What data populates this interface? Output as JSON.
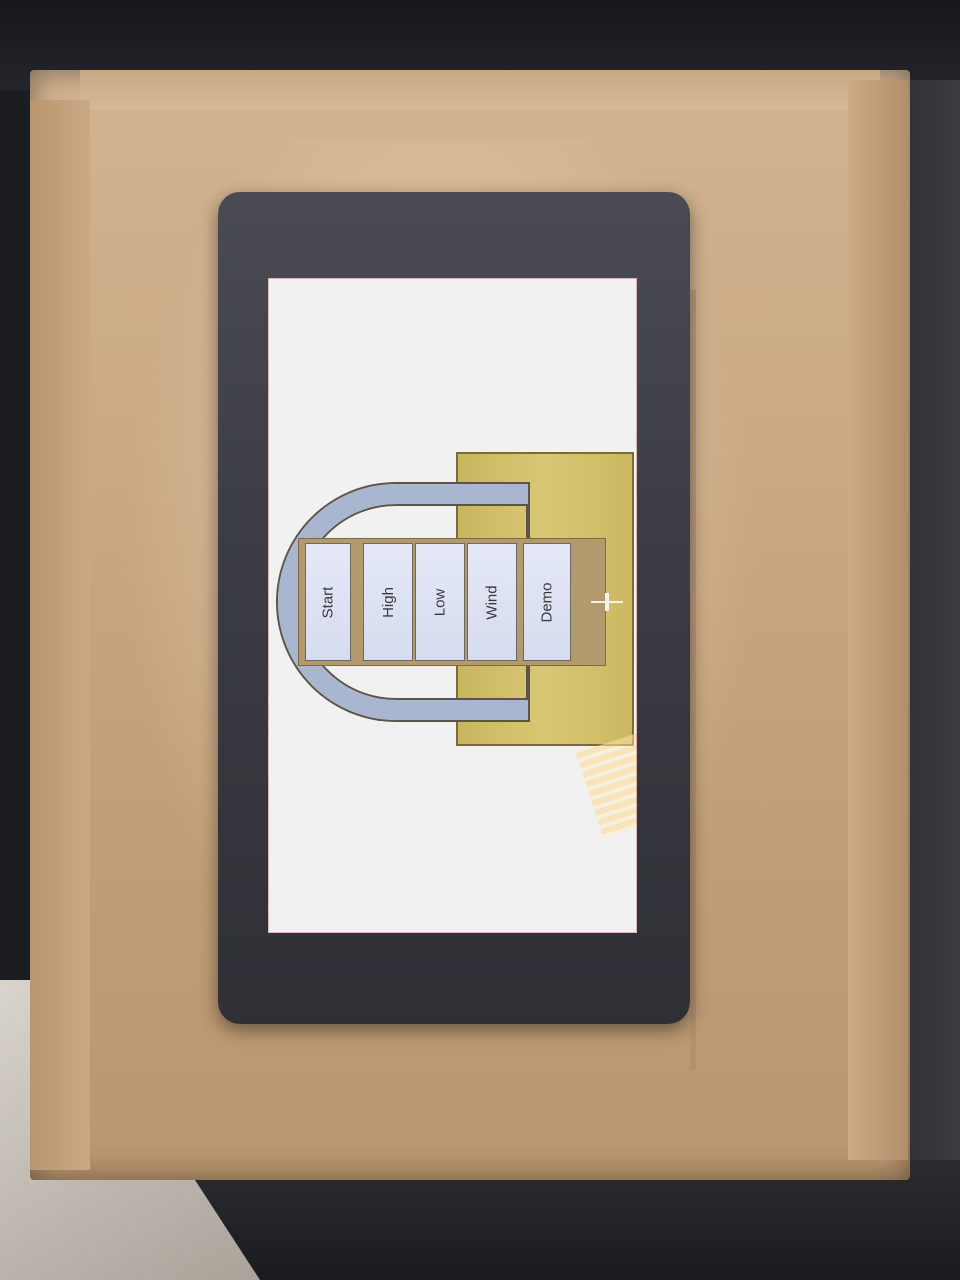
{
  "photo": {
    "subject": "tablet on cardboard box",
    "colors": {
      "lock_body": "#d8c773",
      "shackle": "#a9b6cf",
      "panel": "#b39a6e",
      "button": "#e4e8f6",
      "screen": "#f1f1f1",
      "device": "#3a3a42",
      "box": "#c7a57f"
    }
  },
  "app": {
    "buttons": [
      {
        "label": "Start"
      },
      {
        "label": "High"
      },
      {
        "label": "Low"
      },
      {
        "label": "Wind"
      },
      {
        "label": "Demo"
      }
    ]
  }
}
